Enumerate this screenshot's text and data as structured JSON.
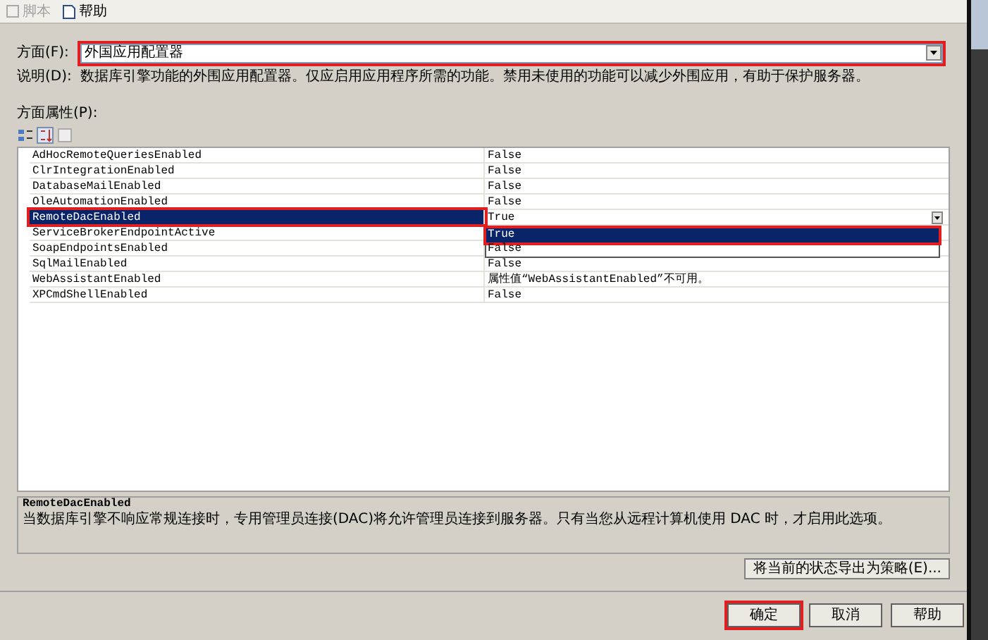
{
  "toolbar": [
    {
      "label": "脚本",
      "disabled": true,
      "kind": "script"
    },
    {
      "label": "帮助",
      "disabled": false,
      "kind": "help"
    }
  ],
  "facet": {
    "label": "方面(F):",
    "value": "外国应用配置器",
    "highlighted": true
  },
  "description": {
    "label": "说明(D):",
    "text": "数据库引擎功能的外围应用配置器。仅应启用应用程序所需的功能。禁用未使用的功能可以减少外围应用，有助于保护服务器。"
  },
  "properties_label": "方面属性(P):",
  "properties": [
    {
      "name": "AdHocRemoteQueriesEnabled",
      "value": "False",
      "selected": false,
      "highlighted": false
    },
    {
      "name": "ClrIntegrationEnabled",
      "value": "False",
      "selected": false,
      "highlighted": false
    },
    {
      "name": "DatabaseMailEnabled",
      "value": "False",
      "selected": false,
      "highlighted": false
    },
    {
      "name": "OleAutomationEnabled",
      "value": "False",
      "selected": false,
      "highlighted": false
    },
    {
      "name": "RemoteDacEnabled",
      "value": "True",
      "selected": true,
      "highlighted": true
    },
    {
      "name": "ServiceBrokerEndpointActive",
      "selected": false,
      "highlighted": false
    },
    {
      "name": "SoapEndpointsEnabled",
      "selected": false,
      "highlighted": false
    },
    {
      "name": "SqlMailEnabled",
      "value": "False",
      "selected": false,
      "highlighted": false
    },
    {
      "name": "WebAssistantEnabled",
      "value": "属性值“WebAssistantEnabled”不可用。",
      "selected": false,
      "highlighted": false
    },
    {
      "name": "XPCmdShellEnabled",
      "value": "False",
      "selected": false,
      "highlighted": false
    }
  ],
  "dropdown": {
    "options": [
      {
        "label": "True",
        "selected": true,
        "highlighted": true
      },
      {
        "label": "False",
        "selected": false,
        "highlighted": false
      }
    ]
  },
  "help_panel": {
    "title": "RemoteDacEnabled",
    "text": "当数据库引擎不响应常规连接时，专用管理员连接(DAC)将允许管理员连接到服务器。只有当您从远程计算机使用 DAC 时，才启用此选项。"
  },
  "export_button": "将当前的状态导出为策略(E)...",
  "buttons": [
    {
      "label": "确定",
      "highlighted": true
    },
    {
      "label": "取消",
      "highlighted": false
    },
    {
      "label": "帮助",
      "highlighted": false
    }
  ]
}
